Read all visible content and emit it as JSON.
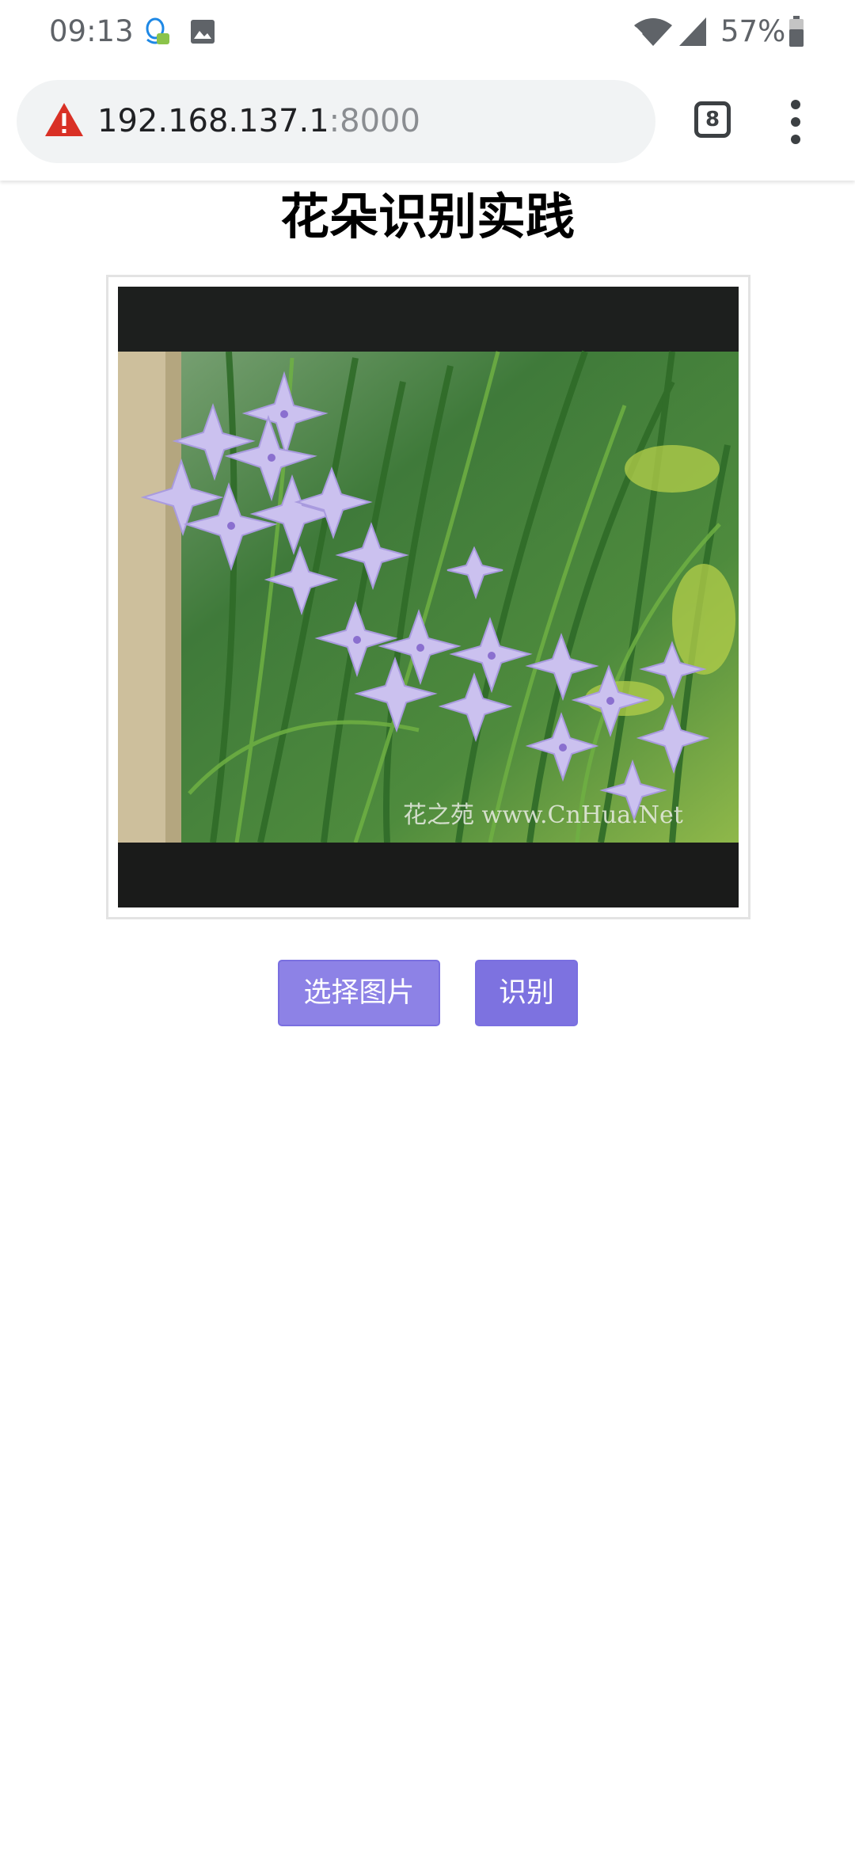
{
  "status_bar": {
    "time": "09:13",
    "battery_percent": "57%",
    "icons": [
      "qq-notification-icon",
      "gallery-notification-icon",
      "wifi-icon",
      "cell-signal-icon",
      "battery-icon"
    ]
  },
  "browser": {
    "url_host": "192.168.137.1",
    "url_port": ":8000",
    "tab_count": "8",
    "security_state": "not-secure-warning"
  },
  "page": {
    "title": "花朵识别实践",
    "image_watermark": "花之苑 www.CnHua.Net",
    "buttons": {
      "select_image": "选择图片",
      "identify": "识别"
    }
  },
  "colors": {
    "button_bg": "#8b7fe4",
    "warning_red": "#d93025",
    "title_text": "#000000"
  }
}
